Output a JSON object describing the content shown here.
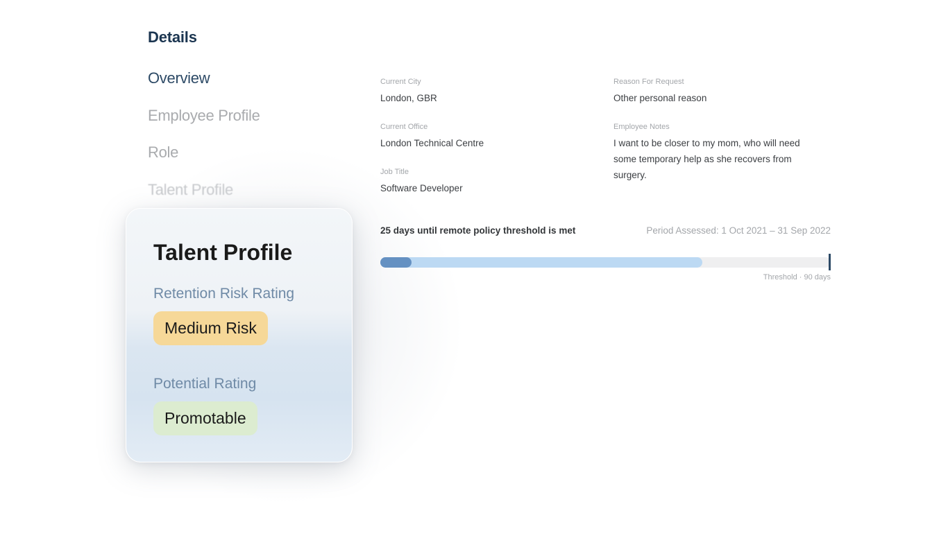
{
  "nav": {
    "heading": "Details",
    "items": [
      {
        "label": "Overview",
        "active": true
      },
      {
        "label": "Employee Profile",
        "active": false
      },
      {
        "label": "Role",
        "active": false
      },
      {
        "label": "Talent Profile",
        "active": false
      }
    ]
  },
  "talent_card": {
    "title": "Talent Profile",
    "retention_label": "Retention Risk Rating",
    "retention_value": "Medium Risk",
    "potential_label": "Potential Rating",
    "potential_value": "Promotable"
  },
  "details": {
    "current_city": {
      "label": "Current City",
      "value": "London, GBR"
    },
    "current_office": {
      "label": "Current Office",
      "value": "London Technical Centre"
    },
    "job_title": {
      "label": "Job Title",
      "value": "Software Developer"
    },
    "reason": {
      "label": "Reason For Request",
      "value": "Other personal reason"
    },
    "notes": {
      "label": "Employee Notes",
      "value": "I want to be closer to my mom, who will need some temporary help as she recovers from surgery."
    }
  },
  "threshold": {
    "title": "25 days until remote policy threshold is met",
    "period": "Period Assessed: 1 Oct 2021 – 31 Sep 2022",
    "caption": "Threshold · 90 days",
    "progress_primary": 0.07,
    "progress_secondary": 0.715
  },
  "colors": {
    "nav_active": "#2d4a66",
    "risk_pill": "#f6d898",
    "potential_pill": "#dcecd0",
    "bar_dark": "#6591c2",
    "bar_light": "#bcd9f3"
  }
}
